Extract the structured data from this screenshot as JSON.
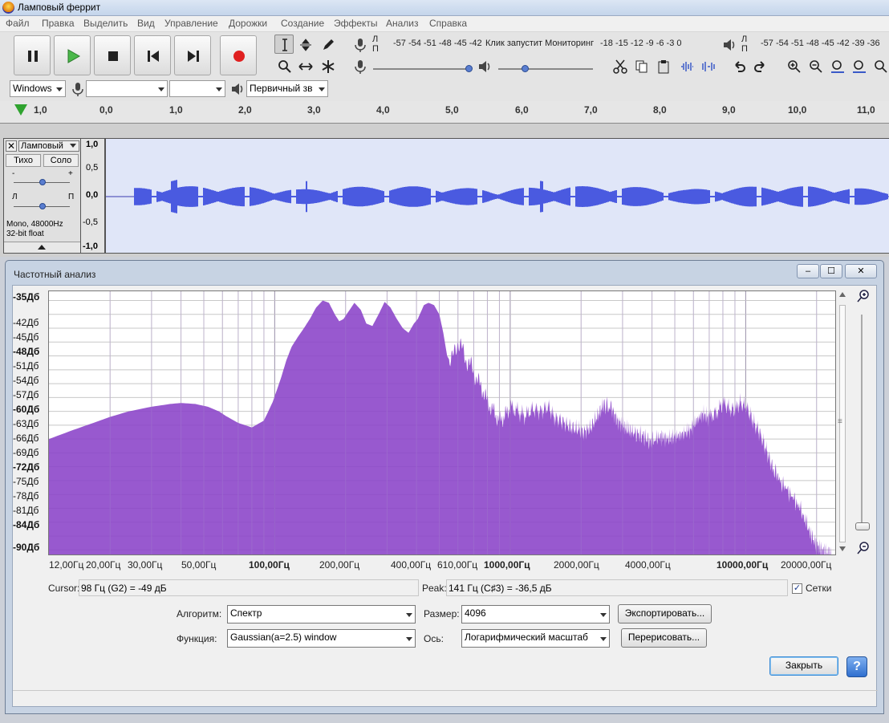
{
  "window": {
    "title": "Ламповый феррит"
  },
  "menu": [
    "Файл",
    "Правка",
    "Выделить",
    "Вид",
    "Управление",
    "Дорожки",
    "Создание",
    "Эффекты",
    "Анализ",
    "Справка"
  ],
  "meters": {
    "rec_scale": "-57 -54 -51 -48 -45 -42",
    "rec_hint": "Клик запустит Мониторинг",
    "rec_scale2": "-18 -15 -12 -9 -6 -3 0",
    "play_scale": "-57 -54 -51 -48 -45 -42 -39 -36",
    "l": "Л",
    "p": "П"
  },
  "device": {
    "host": "Windows",
    "channels": "Первичный зв"
  },
  "ruler": [
    "1,0",
    "0,0",
    "1,0",
    "2,0",
    "3,0",
    "4,0",
    "5,0",
    "6,0",
    "7,0",
    "8,0",
    "9,0",
    "10,0",
    "11,0"
  ],
  "track": {
    "name": "Ламповый",
    "mute": "Тихо",
    "solo": "Соло",
    "gain_minus": "-",
    "gain_plus": "+",
    "pan_left": "Л",
    "pan_right": "П",
    "info1": "Mono, 48000Hz",
    "info2": "32-bit float",
    "scale": [
      "1,0",
      "0,5",
      "0,0",
      "-0,5",
      "-1,0"
    ]
  },
  "analysis": {
    "title": "Частотный анализ",
    "y_labels": [
      "-35Дб",
      "-42Дб",
      "-45Дб",
      "-48Дб",
      "-51Дб",
      "-54Дб",
      "-57Дб",
      "-60Дб",
      "-63Дб",
      "-66Дб",
      "-69Дб",
      "-72Дб",
      "-75Дб",
      "-78Дб",
      "-81Дб",
      "-84Дб",
      "-90Дб"
    ],
    "x_labels": [
      "12,00Гц",
      "20,00Гц",
      "30,00Гц",
      "50,00Гц",
      "100,00Гц",
      "200,00Гц",
      "400,00Гц",
      "610,00Гц",
      "1000,00Гц",
      "2000,00Гц",
      "4000,00Гц",
      "10000,00Гц",
      "20000,00Гц"
    ],
    "cursor_label": "Cursor:",
    "cursor_value": "98 Гц (G2) = -49 дБ",
    "peak_label": "Peak:",
    "peak_value": "141 Гц (C♯3) = -36,5 дБ",
    "grid_label": "Сетки",
    "grid_checked": true,
    "algorithm_label": "Алгоритм:",
    "algorithm_value": "Спектр",
    "function_label": "Функция:",
    "function_value": "Gaussian(a=2.5) window",
    "size_label": "Размер:",
    "size_value": "4096",
    "axis_label": "Ось:",
    "axis_value": "Логарифмический масштаб",
    "export_button": "Экспортировать...",
    "redraw_button": "Перерисовать...",
    "close_button": "Закрыть",
    "help_button": "?"
  },
  "chart_data": {
    "type": "area",
    "title": "",
    "xscale": "log",
    "xlim": [
      11,
      24000
    ],
    "ylim": [
      -91,
      -34
    ],
    "grid": true,
    "color": "#8a42c8",
    "x": [
      11,
      14,
      17,
      20,
      24,
      30,
      36,
      40,
      46,
      52,
      58,
      62,
      70,
      80,
      90,
      98,
      106,
      112,
      118,
      125,
      133,
      141,
      150,
      160,
      170,
      180,
      188,
      196,
      205,
      218,
      232,
      245,
      260,
      276,
      293,
      310,
      330,
      350,
      370,
      390,
      405,
      430,
      450,
      475,
      500,
      520,
      540,
      560,
      580,
      600,
      620,
      650,
      680,
      720,
      760,
      800,
      850,
      900,
      950,
      1000,
      1080,
      1150,
      1250,
      1350,
      1450,
      1550,
      1650,
      1800,
      1950,
      2050,
      2200,
      2350,
      2500,
      2700,
      2850,
      3000,
      3150,
      3300,
      3500,
      3700,
      3900,
      4100,
      4400,
      4700,
      5000,
      5400,
      5800,
      6200,
      6600,
      7000,
      7500,
      8000,
      8500,
      9000,
      9500,
      10000,
      10500,
      11000,
      11500,
      12000,
      12500,
      13000,
      14000,
      15000,
      16000,
      17000,
      18000,
      19000,
      20000,
      21000,
      22000,
      23000
    ],
    "y": [
      -66,
      -64,
      -62.5,
      -61.2,
      -60,
      -59,
      -58.4,
      -58.2,
      -58.4,
      -59,
      -60,
      -61,
      -62.5,
      -63.5,
      -62,
      -58,
      -53,
      -49,
      -46,
      -44,
      -42,
      -40,
      -37.5,
      -36,
      -36.5,
      -39,
      -40.5,
      -40,
      -38.5,
      -36.5,
      -38,
      -41,
      -41.5,
      -39,
      -36.3,
      -37.5,
      -40,
      -42,
      -43,
      -41,
      -40,
      -37,
      -36.5,
      -37,
      -39,
      -43,
      -48,
      -49.5,
      -47,
      -45,
      -46,
      -49,
      -50,
      -53,
      -55,
      -58,
      -60,
      -62,
      -61,
      -59,
      -60,
      -61,
      -59.5,
      -60,
      -59,
      -61.5,
      -62,
      -63.5,
      -64,
      -64.5,
      -63.5,
      -61,
      -58.5,
      -59.5,
      -62,
      -63,
      -64,
      -64.5,
      -65,
      -65.5,
      -66.5,
      -66,
      -65.5,
      -66,
      -65.5,
      -65,
      -64,
      -62,
      -60.5,
      -61.5,
      -60,
      -58.5,
      -59,
      -60,
      -58,
      -59,
      -61,
      -63,
      -65,
      -67,
      -70,
      -72,
      -75,
      -77,
      -79,
      -81,
      -84,
      -87,
      -89,
      -90,
      -90.5,
      -91
    ]
  }
}
